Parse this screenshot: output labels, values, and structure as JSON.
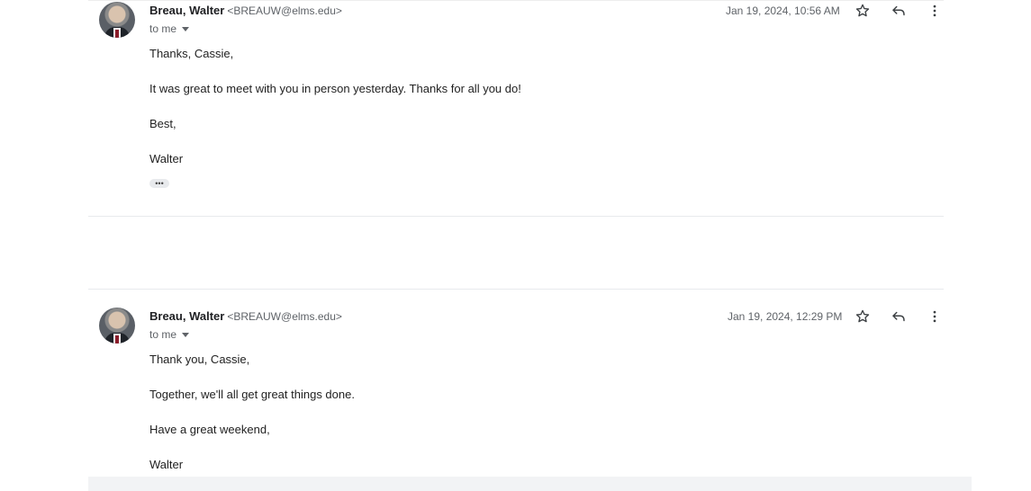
{
  "messages": [
    {
      "sender_name": "Breau, Walter",
      "sender_email": "<BREAUW@elms.edu>",
      "recipient": "to me",
      "date": "Jan 19, 2024, 10:56 AM",
      "body": [
        "Thanks, Cassie,",
        "It was great to meet with you in person yesterday. Thanks for all you do!",
        "Best,",
        "Walter"
      ],
      "trimmed_content_label": "•••"
    },
    {
      "sender_name": "Breau, Walter",
      "sender_email": "<BREAUW@elms.edu>",
      "recipient": "to me",
      "date": "Jan 19, 2024, 12:29 PM",
      "body": [
        "Thank you, Cassie,",
        "Together, we'll all get great things done.",
        "Have a great weekend,",
        "Walter"
      ]
    }
  ],
  "icons": {
    "star": "star-icon",
    "reply": "reply-icon",
    "more": "more-vert-icon"
  },
  "colors": {
    "secondary_text": "#5f6368",
    "primary_text": "#202124",
    "divider": "#e8eaed"
  }
}
